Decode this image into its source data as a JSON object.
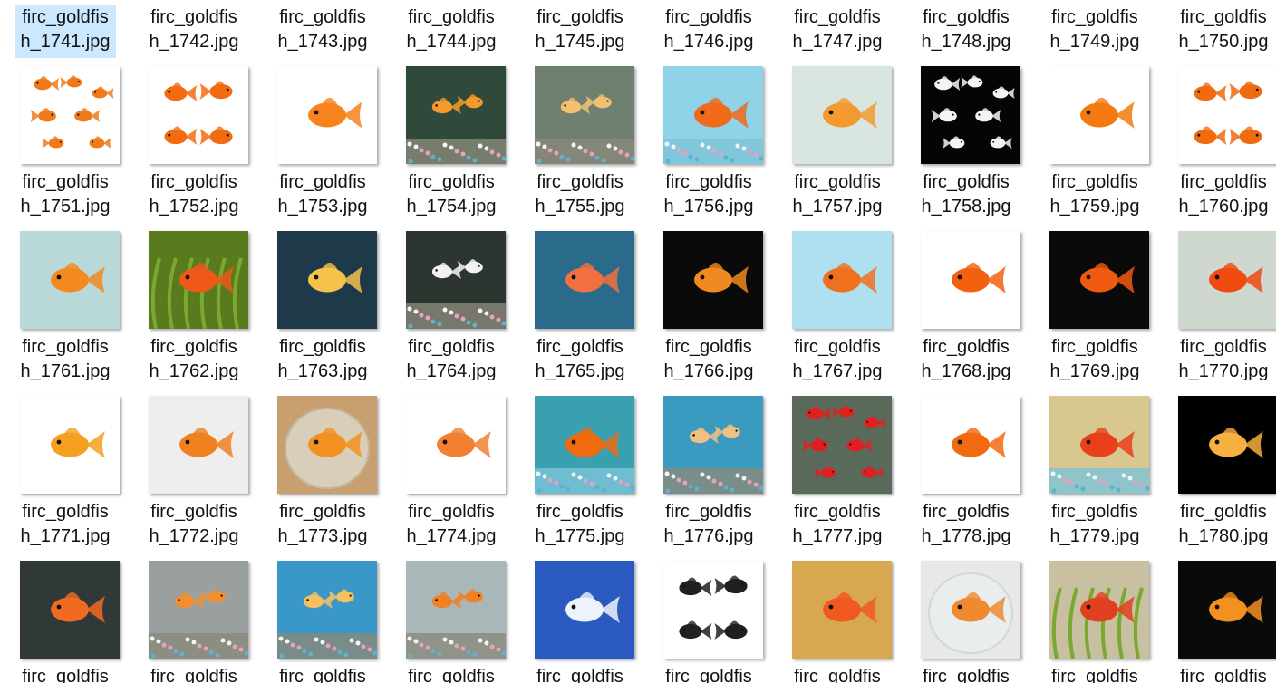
{
  "files": {
    "selected_index": 0,
    "columns": 10,
    "first_row_labels": [
      "firc_goldfis\nh_1741.jpg",
      "firc_goldfis\nh_1742.jpg",
      "firc_goldfis\nh_1743.jpg",
      "firc_goldfis\nh_1744.jpg",
      "firc_goldfis\nh_1745.jpg",
      "firc_goldfis\nh_1746.jpg",
      "firc_goldfis\nh_1747.jpg",
      "firc_goldfis\nh_1748.jpg",
      "firc_goldfis\nh_1749.jpg",
      "firc_goldfis\nh_1750.jpg"
    ],
    "rows": [
      {
        "thumbs": [
          {
            "bg": "#ffffff",
            "fish": "#f07a1a",
            "scene": "many"
          },
          {
            "bg": "#ffffff",
            "fish": "#f26b10",
            "scene": "four"
          },
          {
            "bg": "#ffffff",
            "fish": "#f6831c",
            "scene": "single"
          },
          {
            "bg": "#2f4a3a",
            "fish": "#f49a2a",
            "scene": "tank"
          },
          {
            "bg": "#6f7f70",
            "fish": "#f2c070",
            "scene": "tank"
          },
          {
            "bg": "#8fd3e8",
            "fish": "#f06a1a",
            "scene": "pebbles"
          },
          {
            "bg": "#d9e6e0",
            "fish": "#f29a30",
            "scene": "single"
          },
          {
            "bg": "#050505",
            "fish": "#f4f4f4",
            "scene": "many"
          },
          {
            "bg": "#ffffff",
            "fish": "#f27a10",
            "scene": "single"
          },
          {
            "bg": "#ffffff",
            "fish": "#f06a10",
            "scene": "four"
          }
        ],
        "labels": [
          "firc_goldfis\nh_1751.jpg",
          "firc_goldfis\nh_1752.jpg",
          "firc_goldfis\nh_1753.jpg",
          "firc_goldfis\nh_1754.jpg",
          "firc_goldfis\nh_1755.jpg",
          "firc_goldfis\nh_1756.jpg",
          "firc_goldfis\nh_1757.jpg",
          "firc_goldfis\nh_1758.jpg",
          "firc_goldfis\nh_1759.jpg",
          "firc_goldfis\nh_1760.jpg"
        ]
      },
      {
        "thumbs": [
          {
            "bg": "#b9d8d8",
            "fish": "#f28a20",
            "scene": "single"
          },
          {
            "bg": "#5a7a1e",
            "fish": "#f0581a",
            "scene": "plants"
          },
          {
            "bg": "#1e3a4a",
            "fish": "#f5c24a",
            "scene": "single"
          },
          {
            "bg": "#2d3530",
            "fish": "#f2f2f6",
            "scene": "tank"
          },
          {
            "bg": "#2a6a8a",
            "fish": "#f27040",
            "scene": "single"
          },
          {
            "bg": "#0a0a0a",
            "fish": "#f08a20",
            "scene": "single"
          },
          {
            "bg": "#aee0f0",
            "fish": "#f07020",
            "scene": "single"
          },
          {
            "bg": "#ffffff",
            "fish": "#f26010",
            "scene": "single"
          },
          {
            "bg": "#0a0a0a",
            "fish": "#f05a10",
            "scene": "single"
          },
          {
            "bg": "#cfd8cf",
            "fish": "#f04a10",
            "scene": "single"
          }
        ],
        "labels": [
          "firc_goldfis\nh_1761.jpg",
          "firc_goldfis\nh_1762.jpg",
          "firc_goldfis\nh_1763.jpg",
          "firc_goldfis\nh_1764.jpg",
          "firc_goldfis\nh_1765.jpg",
          "firc_goldfis\nh_1766.jpg",
          "firc_goldfis\nh_1767.jpg",
          "firc_goldfis\nh_1768.jpg",
          "firc_goldfis\nh_1769.jpg",
          "firc_goldfis\nh_1770.jpg"
        ]
      },
      {
        "thumbs": [
          {
            "bg": "#ffffff",
            "fish": "#f5a020",
            "scene": "single"
          },
          {
            "bg": "#eeeeee",
            "fish": "#f08020",
            "scene": "single"
          },
          {
            "bg": "#c8a070",
            "fish": "#f29020",
            "scene": "bowl"
          },
          {
            "bg": "#ffffff",
            "fish": "#f28030",
            "scene": "single"
          },
          {
            "bg": "#3aa0b0",
            "fish": "#f06a10",
            "scene": "pebbles"
          },
          {
            "bg": "#3a9ac0",
            "fish": "#f0c080",
            "scene": "tank"
          },
          {
            "bg": "#5a6a5a",
            "fish": "#e02020",
            "scene": "many"
          },
          {
            "bg": "#ffffff",
            "fish": "#f26a10",
            "scene": "single"
          },
          {
            "bg": "#d8c890",
            "fish": "#e8401a",
            "scene": "pebbles"
          },
          {
            "bg": "#000000",
            "fish": "#f5b040",
            "scene": "single"
          }
        ],
        "labels": [
          "firc_goldfis\nh_1771.jpg",
          "firc_goldfis\nh_1772.jpg",
          "firc_goldfis\nh_1773.jpg",
          "firc_goldfis\nh_1774.jpg",
          "firc_goldfis\nh_1775.jpg",
          "firc_goldfis\nh_1776.jpg",
          "firc_goldfis\nh_1777.jpg",
          "firc_goldfis\nh_1778.jpg",
          "firc_goldfis\nh_1779.jpg",
          "firc_goldfis\nh_1780.jpg"
        ]
      },
      {
        "thumbs": [
          {
            "bg": "#303838",
            "fish": "#f06a20",
            "scene": "single"
          },
          {
            "bg": "#9aa0a0",
            "fish": "#f09030",
            "scene": "tank"
          },
          {
            "bg": "#3a98c8",
            "fish": "#f4c060",
            "scene": "tank"
          },
          {
            "bg": "#a8b8b8",
            "fish": "#f08020",
            "scene": "tank"
          },
          {
            "bg": "#2a5ac0",
            "fish": "#eef2fa",
            "scene": "single"
          },
          {
            "bg": "#ffffff",
            "fish": "#202020",
            "scene": "four"
          },
          {
            "bg": "#d8a850",
            "fish": "#f05a20",
            "scene": "single"
          },
          {
            "bg": "#e8e8e8",
            "fish": "#f08a30",
            "scene": "bowl"
          },
          {
            "bg": "#c8c0a0",
            "fish": "#e04020",
            "scene": "plants"
          },
          {
            "bg": "#0a0a0a",
            "fish": "#f29020",
            "scene": "single"
          }
        ],
        "labels": [
          "firc_goldfis",
          "firc_goldfis",
          "firc_goldfis",
          "firc_goldfis",
          "firc_goldfis",
          "firc_goldfis",
          "firc_goldfis",
          "firc_goldfis",
          "firc_goldfis",
          "firc_goldfis"
        ]
      }
    ]
  }
}
